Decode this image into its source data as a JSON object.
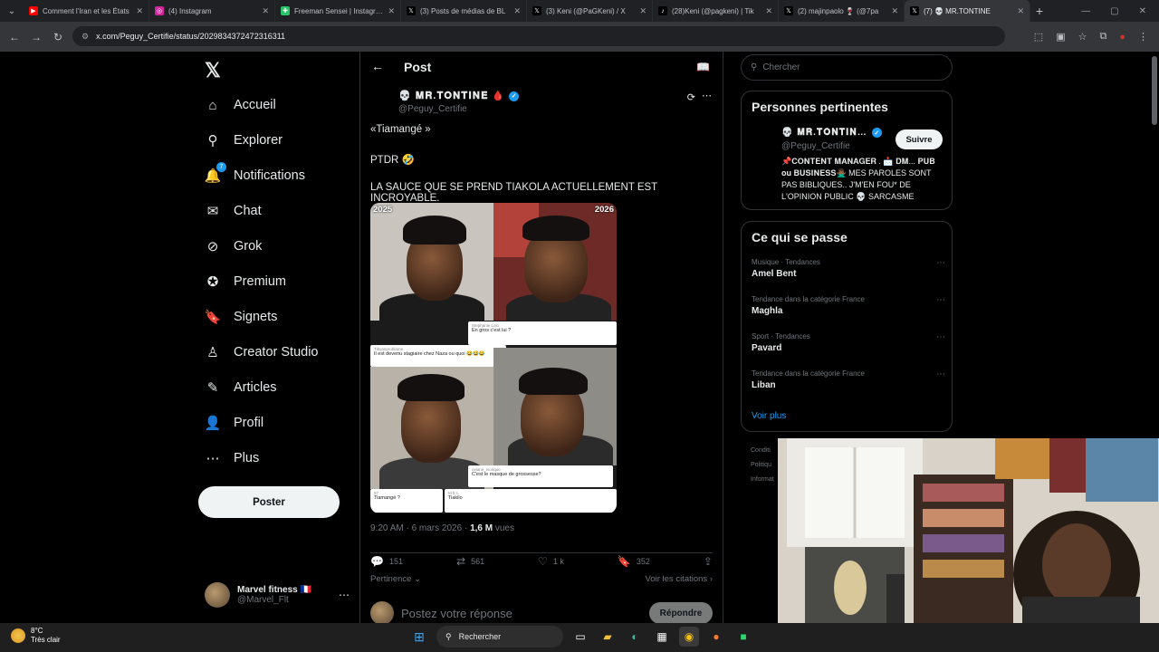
{
  "browser": {
    "tabs": [
      {
        "title": "Comment l'Iran et les États",
        "color": "#ff0000",
        "glyph": "▶"
      },
      {
        "title": "(4) Instagram",
        "color": "#d6249f",
        "glyph": "◎"
      },
      {
        "title": "Freeman Sensei | Instagram",
        "color": "#29c36a",
        "glyph": "✚"
      },
      {
        "title": "(3) Posts de médias de BL",
        "color": "#000000",
        "glyph": "𝕏"
      },
      {
        "title": "(3) Keni (@PaGKeni) / X",
        "color": "#000000",
        "glyph": "𝕏"
      },
      {
        "title": "(28)Keni (@pagkeni) | Tik",
        "color": "#000000",
        "glyph": "♪"
      },
      {
        "title": "(2) majinpaolo 🍷 (@7pa",
        "color": "#000000",
        "glyph": "𝕏"
      },
      {
        "title": "(7) 💀 MR.TONTINE",
        "color": "#000000",
        "glyph": "𝕏"
      }
    ],
    "url": "x.com/Peguy_Certifie/status/2029834372472316311"
  },
  "nav": {
    "items": [
      {
        "label": "Accueil",
        "icon": "⌂",
        "name": "home"
      },
      {
        "label": "Explorer",
        "icon": "⚲",
        "name": "explore"
      },
      {
        "label": "Notifications",
        "icon": "🔔",
        "name": "notifications",
        "badge": "7"
      },
      {
        "label": "Chat",
        "icon": "✉",
        "name": "chat"
      },
      {
        "label": "Grok",
        "icon": "⊘",
        "name": "grok"
      },
      {
        "label": "Premium",
        "icon": "✪",
        "name": "premium"
      },
      {
        "label": "Signets",
        "icon": "🔖",
        "name": "bookmarks"
      },
      {
        "label": "Creator Studio",
        "icon": "♙",
        "name": "creator-studio"
      },
      {
        "label": "Articles",
        "icon": "✎",
        "name": "articles"
      },
      {
        "label": "Profil",
        "icon": "👤",
        "name": "profile"
      },
      {
        "label": "Plus",
        "icon": "⋯",
        "name": "more"
      }
    ],
    "post_button": "Poster",
    "account": {
      "name": "Marvel fitness 🇫🇷",
      "handle": "@Marvel_Flt"
    }
  },
  "post": {
    "header_title": "Post",
    "author_name": "💀 𝐌𝐑.𝐓𝐎𝐍𝐓𝐈𝐍𝐄 🩸",
    "author_handle": "@Peguy_Certifie",
    "lines": [
      "«Tiamangé »",
      "PTDR 🤣",
      "LA SAUCE QUE SE PREND TIAKOLA ACTUELLEMENT EST INCROYABLE."
    ],
    "media": {
      "year_left": "2025",
      "year_right": "2026",
      "comments": [
        {
          "user": "Stephanie Lolo",
          "text": "En gros c'est lui ?"
        },
        {
          "user": "Tibyanproblame",
          "text": "Il est devenu stagiaire chez Naza ou quoi 😂😂😂"
        },
        {
          "user": "oviane_Ivorique",
          "text": "C'est le masque de grossesse?"
        },
        {
          "user": "87",
          "text": "Tiamangé ?"
        },
        {
          "user": "M E L",
          "text": "Tiakilo"
        }
      ]
    },
    "timestamp": "9:20 AM · 6 mars 2026 · ",
    "views_count": "1,6 M",
    "views_label": " vues",
    "replies": "151",
    "reposts": "561",
    "likes": "1 k",
    "bookmarks": "352",
    "sort_label": "Pertinence",
    "quotes_label": "Voir les citations",
    "reply_placeholder": "Postez votre réponse",
    "reply_button": "Répondre"
  },
  "sidebar": {
    "search_placeholder": "Chercher",
    "relevant_title": "Personnes pertinentes",
    "relevant": {
      "name": "💀 𝐌𝐑.𝐓𝐎𝐍𝐓𝐈𝐍…",
      "handle": "@Peguy_Certifie",
      "follow": "Suivre",
      "bio": "📌𝐂𝐎𝐍𝐓𝐄𝐍𝐓 𝐌𝐀𝐍𝐀𝐆𝐄𝐑 . 📩 𝐃𝐌... 𝐏𝐔𝐁 𝐨𝐮 𝐁𝐔𝐒𝐈𝐍𝐄𝐒𝐒🙅🏾‍♂️ MES PAROLES SONT PAS BIBLIQUES.. J'M'EN FOU* DE L'OPINION PUBLIC 💀 SARCASME"
    },
    "trends_title": "Ce qui se passe",
    "trends": [
      {
        "meta": "Musique · Tendances",
        "name": "Amel Bent"
      },
      {
        "meta": "Tendance dans la catégorie France",
        "name": "Maghla"
      },
      {
        "meta": "Sport · Tendances",
        "name": "Pavard"
      },
      {
        "meta": "Tendance dans la catégorie France",
        "name": "Liban"
      }
    ],
    "see_more": "Voir plus",
    "footer": [
      "Conditi",
      "Politiqu",
      "Informat"
    ]
  },
  "taskbar": {
    "temp": "8°C",
    "weather": "Très clair",
    "search": "Rechercher"
  },
  "colors": {
    "accent": "#1d9bf0",
    "background": "#000000",
    "border": "#2f3336",
    "muted": "#71767b"
  }
}
